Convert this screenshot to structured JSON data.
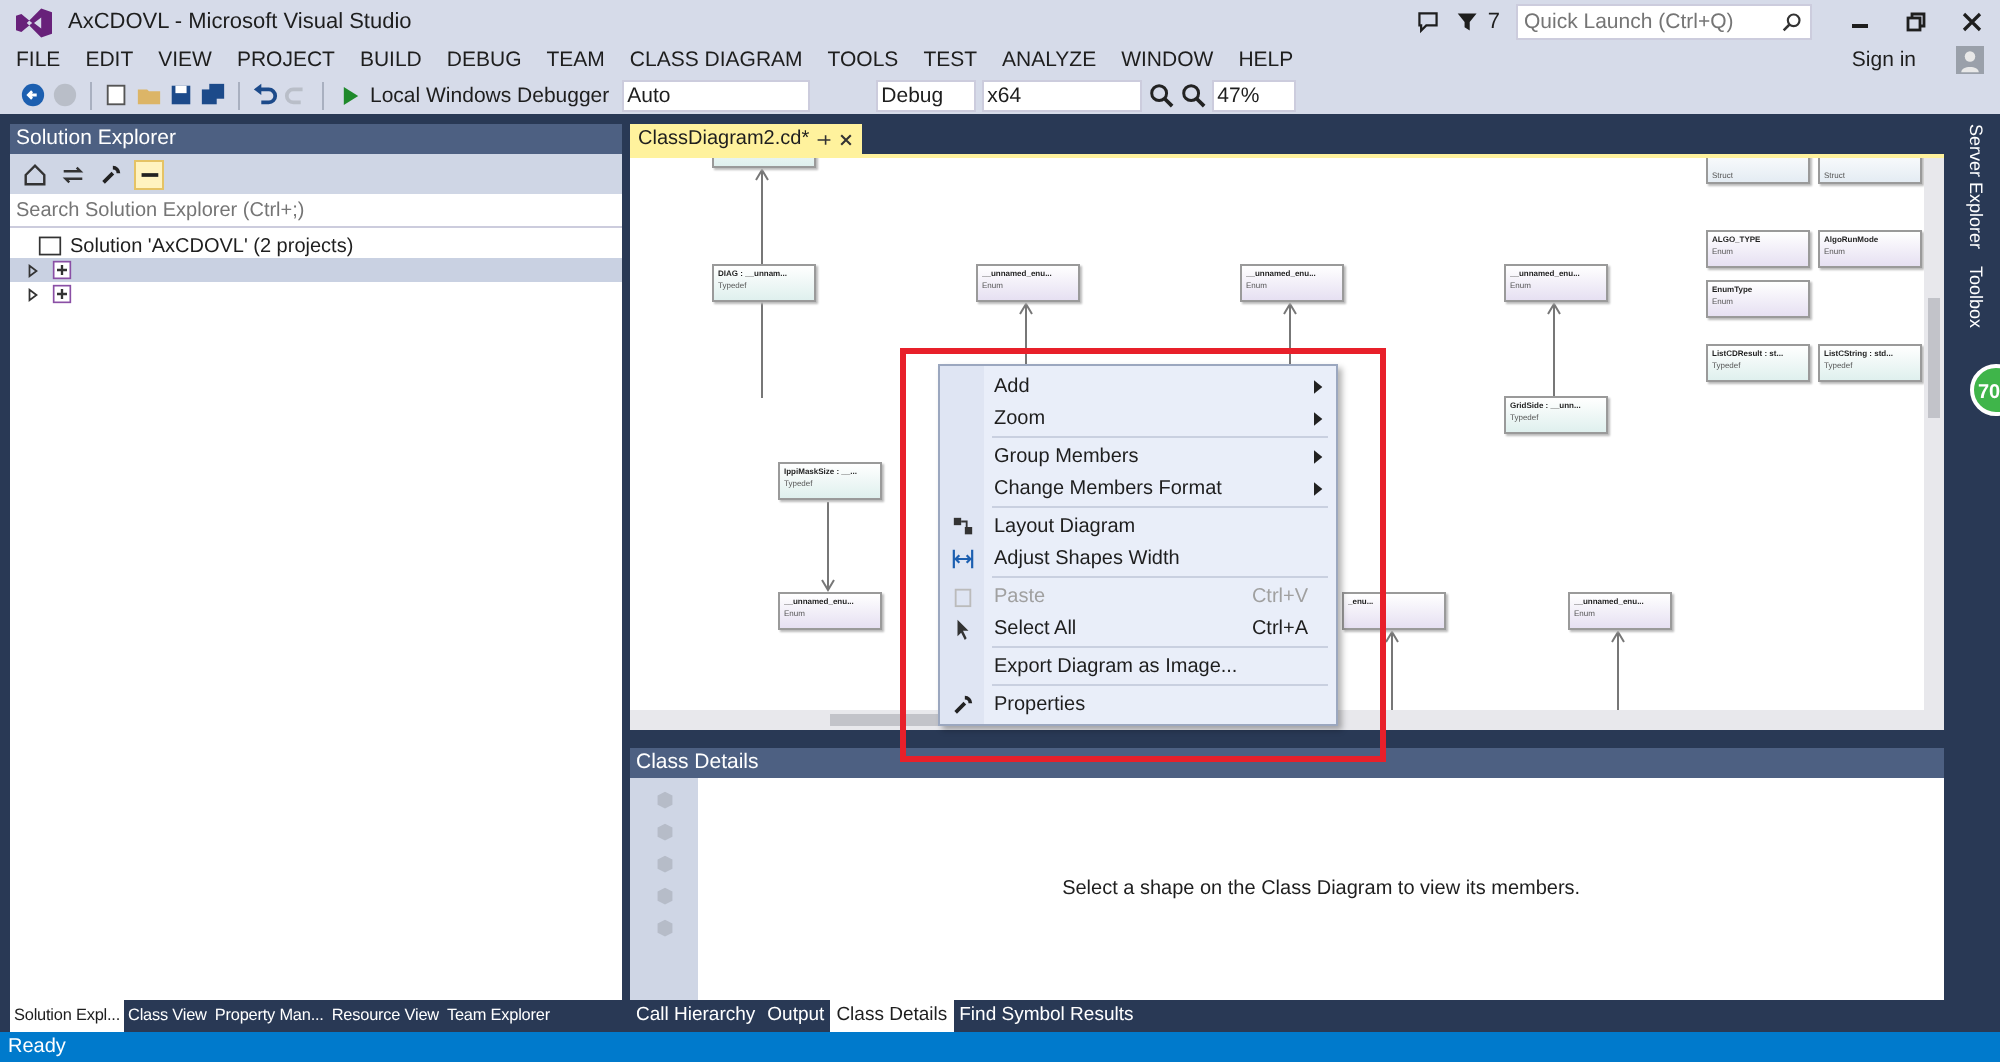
{
  "window": {
    "title": "AxCDOVL - Microsoft Visual Studio",
    "notification_count": "7",
    "quick_launch": {
      "placeholder": "Quick Launch (Ctrl+Q)"
    },
    "sign_in": "Sign in"
  },
  "menu": [
    "FILE",
    "EDIT",
    "VIEW",
    "PROJECT",
    "BUILD",
    "DEBUG",
    "TEAM",
    "CLASS DIAGRAM",
    "TOOLS",
    "TEST",
    "ANALYZE",
    "WINDOW",
    "HELP"
  ],
  "toolbar": {
    "debugger": "Local Windows Debugger",
    "combos": [
      {
        "value": "Auto"
      },
      {
        "value": "Debug"
      },
      {
        "value": "x64"
      },
      {
        "value": "47%"
      }
    ]
  },
  "solution_explorer": {
    "title": "Solution Explorer",
    "search": {
      "placeholder": "Search Solution Explorer (Ctrl+;)"
    },
    "tree": {
      "label": "Solution 'AxCDOVL' (2 projects)",
      "children": [
        {
          "selected": true,
          "expanded": false
        },
        {
          "selected": false,
          "expanded": false
        }
      ]
    }
  },
  "left_tabs": [
    {
      "label": "Solution Expl...",
      "selected": true
    },
    {
      "label": "Class View",
      "selected": false
    },
    {
      "label": "Property Man...",
      "selected": false
    },
    {
      "label": "Resource View",
      "selected": false
    },
    {
      "label": "Team Explorer",
      "selected": false
    }
  ],
  "document_tab": {
    "label": "ClassDiagram2.cd*",
    "selected": true
  },
  "diagram": {
    "shapes": [
      {
        "kind": "typedef"
      },
      {
        "name": "DIAG : __unnam...",
        "stereotype": "Typedef",
        "kind": "typedef"
      },
      {
        "name": "__unnamed_enu...",
        "stereotype": "Enum",
        "kind": "enum"
      },
      {
        "name": "__unnamed_enu...",
        "stereotype": "Enum",
        "kind": "enum"
      },
      {
        "name": "__unnamed_enu...",
        "stereotype": "Enum",
        "kind": "enum"
      },
      {
        "stereotype": "Struct",
        "kind": "struct"
      },
      {
        "stereotype": "Struct",
        "kind": "struct"
      },
      {
        "name": "ALGO_TYPE",
        "stereotype": "Enum",
        "kind": "enum"
      },
      {
        "name": "AlgoRunMode",
        "stereotype": "Enum",
        "kind": "enum"
      },
      {
        "name": "EnumType",
        "stereotype": "Enum",
        "kind": "enum"
      },
      {
        "name": "ListCDResult : st...",
        "stereotype": "Typedef",
        "kind": "typedef"
      },
      {
        "name": "ListCString : std...",
        "stereotype": "Typedef",
        "kind": "typedef"
      },
      {
        "name": "GridSide : __unn...",
        "stereotype": "Typedef",
        "kind": "typedef"
      },
      {
        "name": "IppiMaskSize : __...",
        "stereotype": "Typedef",
        "kind": "typedef"
      },
      {
        "name": "__unnamed_enu...",
        "stereotype": "Enum",
        "kind": "enum"
      },
      {
        "name": "_enu...",
        "kind": "enum"
      },
      {
        "name": "__unnamed_enu...",
        "stereotype": "Enum",
        "kind": "enum"
      }
    ]
  },
  "context_menu": {
    "groups": [
      [
        {
          "label": "Add",
          "submenu": true,
          "disabled": false
        },
        {
          "label": "Zoom",
          "submenu": true,
          "disabled": false
        }
      ],
      [
        {
          "label": "Group Members",
          "submenu": true,
          "disabled": false
        },
        {
          "label": "Change Members Format",
          "submenu": true,
          "disabled": false
        }
      ],
      [
        {
          "label": "Layout Diagram",
          "submenu": false,
          "disabled": false
        },
        {
          "label": "Adjust Shapes Width",
          "submenu": false,
          "disabled": false
        }
      ],
      [
        {
          "label": "Paste",
          "shortcut": "Ctrl+V",
          "submenu": false,
          "disabled": true
        },
        {
          "label": "Select All",
          "shortcut": "Ctrl+A",
          "submenu": false,
          "disabled": false
        }
      ],
      [
        {
          "label": "Export Diagram as Image...",
          "submenu": false,
          "disabled": false
        }
      ],
      [
        {
          "label": "Properties",
          "submenu": false,
          "disabled": false
        }
      ]
    ]
  },
  "class_details": {
    "title": "Class Details",
    "message": "Select a shape on the Class Diagram to view its members."
  },
  "bottom_tabs": [
    {
      "label": "Call Hierarchy",
      "selected": false
    },
    {
      "label": "Output",
      "selected": false
    },
    {
      "label": "Class Details",
      "selected": true
    },
    {
      "label": "Find Symbol Results",
      "selected": false
    }
  ],
  "side_tabs": [
    "Server Explorer",
    "Toolbox"
  ],
  "badge": "70",
  "status_bar": "Ready"
}
